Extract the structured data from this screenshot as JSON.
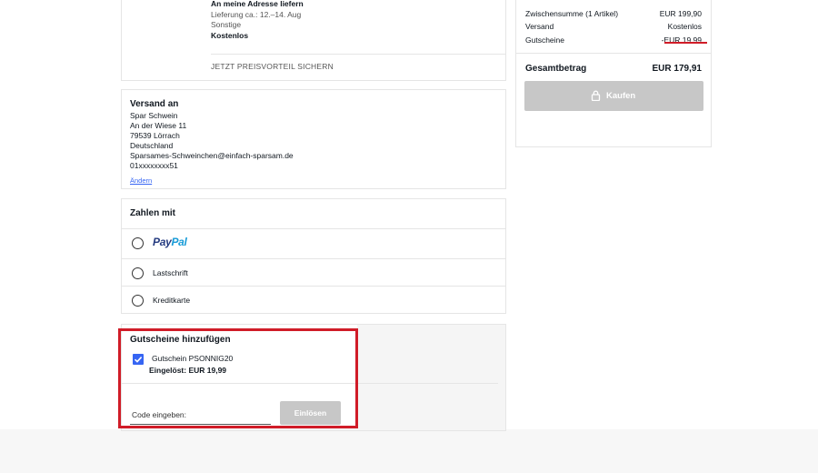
{
  "shipping_option": {
    "title": "An meine Adresse liefern",
    "delivery": "Lieferung ca.: 12.–14. Aug",
    "carrier": "Sonstige",
    "cost": "Kostenlos",
    "promo_link": "JETZT PREISVORTEIL SICHERN"
  },
  "address": {
    "title": "Versand an",
    "lines": [
      "Spar Schwein",
      "An der Wiese 11",
      "79539 Lörrach",
      "Deutschland",
      "Sparsames-Schweinchen@einfach-sparsam.de",
      "01xxxxxxxx51"
    ],
    "change_label": "Ändern"
  },
  "payment": {
    "title": "Zahlen mit",
    "methods": [
      {
        "label_part1": "Pay",
        "label_part2": "Pal",
        "icon": "paypal-logo"
      },
      {
        "label": "Lastschrift"
      },
      {
        "label": "Kreditkarte"
      }
    ]
  },
  "coupons": {
    "title": "Gutscheine hinzufügen",
    "applied_name": "Gutschein PSONNIG20",
    "applied_status": "Eingelöst: EUR 19,99",
    "code_label": "Code eingeben:",
    "redeem_label": "Einlösen",
    "checked": true
  },
  "summary": {
    "subtotal_label": "Zwischensumme (1 Artikel)",
    "subtotal_value": "EUR 199,90",
    "shipping_label": "Versand",
    "shipping_value": "Kostenlos",
    "coupon_label": "Gutscheine",
    "coupon_value": "-EUR 19,99",
    "total_label": "Gesamtbetrag",
    "total_value": "EUR 179,91",
    "buy_label": "Kaufen"
  },
  "colors": {
    "highlight": "#d01c28",
    "link": "#3665f3",
    "disabled_button": "#c7c7c7"
  }
}
